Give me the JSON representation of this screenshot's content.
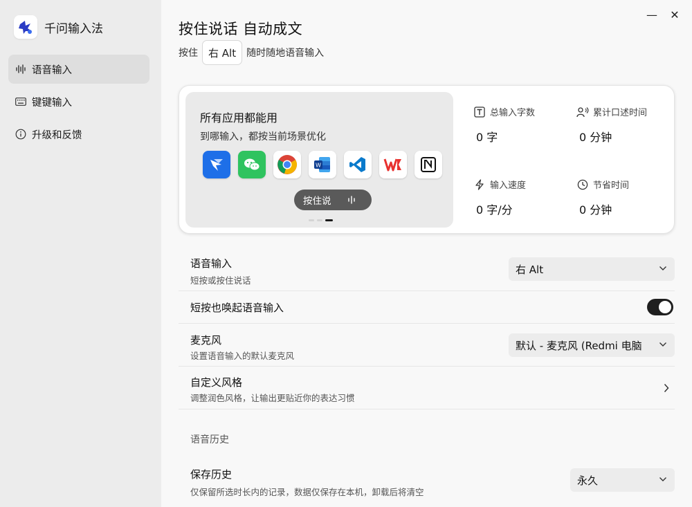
{
  "app": {
    "name": "千问输入法"
  },
  "sidebar": {
    "items": [
      {
        "label": "语音输入",
        "icon": "waveform-icon",
        "active": true
      },
      {
        "label": "键键输入",
        "icon": "keyboard-icon",
        "active": false
      },
      {
        "label": "升级和反馈",
        "icon": "info-icon",
        "active": false
      }
    ]
  },
  "window": {
    "minimize": "—",
    "close": "✕"
  },
  "header": {
    "title": "按住说话 自动成文",
    "sub_prefix": "按住",
    "hotkey": "右 Alt",
    "sub_suffix": "随时随地语音输入"
  },
  "promo": {
    "title": "所有应用都能用",
    "subtitle": "到哪输入，都按当前场景优化",
    "apps": [
      "feishu-icon",
      "wechat-icon",
      "chrome-icon",
      "word-icon",
      "vscode-icon",
      "wps-icon",
      "notion-icon"
    ],
    "ptt_label": "按住说",
    "carousel_active": 3,
    "carousel_count": 3
  },
  "stats": [
    {
      "label": "总输入字数",
      "value": "0 字",
      "icon": "text-box-icon"
    },
    {
      "label": "累计口述时间",
      "value": "0 分钟",
      "icon": "speaking-person-icon"
    },
    {
      "label": "输入速度",
      "value": "0 字/分",
      "icon": "lightning-icon"
    },
    {
      "label": "节省时间",
      "value": "0 分钟",
      "icon": "clock-icon"
    }
  ],
  "settings": {
    "voice_input": {
      "title": "语音输入",
      "desc": "短按或按住说话",
      "value": "右 Alt"
    },
    "short_press": {
      "title": "短按也唤起语音输入",
      "enabled": true
    },
    "microphone": {
      "title": "麦克风",
      "desc": "设置语音输入的默认麦克风",
      "value": "默认 - 麦克风 (Redmi 电脑"
    },
    "custom_style": {
      "title": "自定义风格",
      "desc": "调整润色风格，让输出更贴近你的表达习惯"
    },
    "history_section": "语音历史",
    "save_history": {
      "title": "保存历史",
      "desc": "仅保留所选时长内的记录，数据仅保存在本机，卸载后将清空",
      "value": "永久"
    }
  },
  "colors": {
    "accent": "#1f1f1f",
    "brand": "#2b3cc4",
    "sidebar_active": "#dedede"
  }
}
